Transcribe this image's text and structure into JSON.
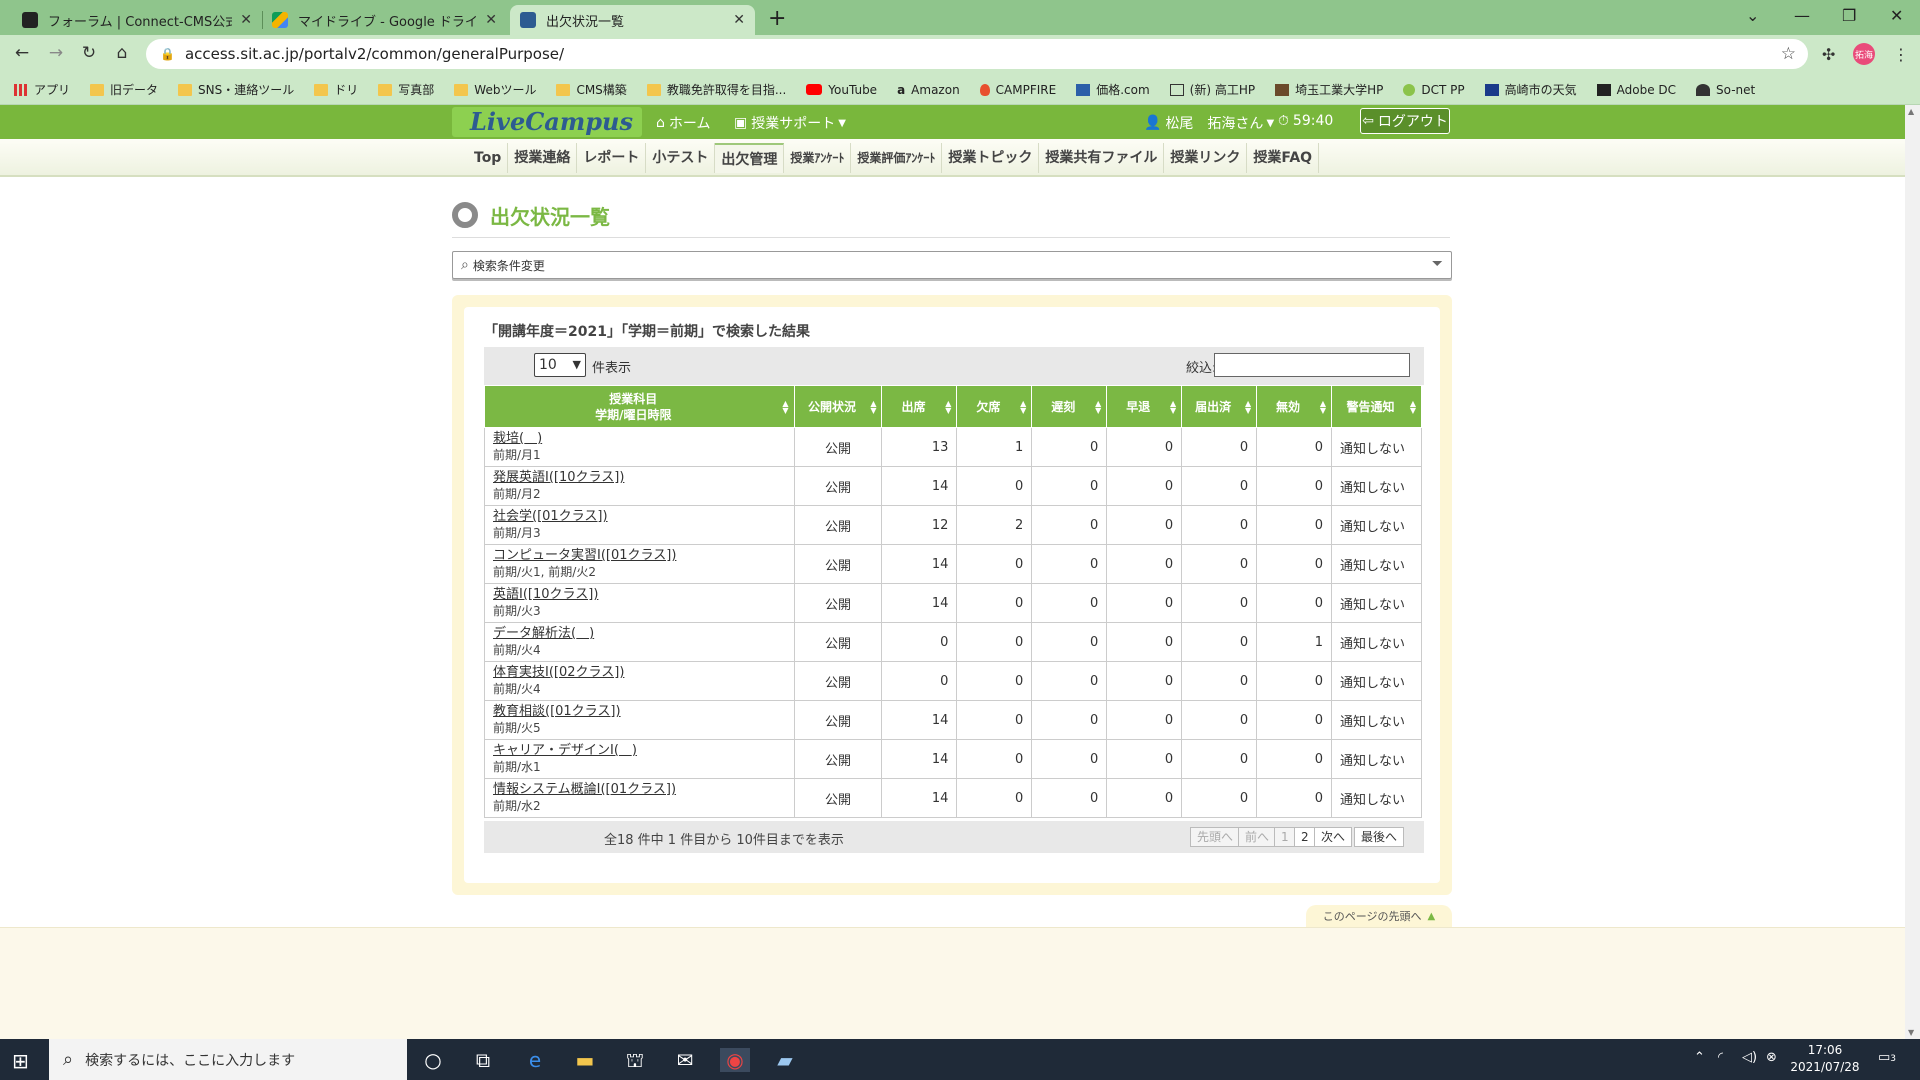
{
  "browser": {
    "tabs": [
      {
        "label": "フォーラム | Connect-CMS公式サイト"
      },
      {
        "label": "マイドライブ - Google ドライブ"
      },
      {
        "label": "出欠状況一覧"
      }
    ],
    "url": "access.sit.ac.jp/portalv2/common/generalPurpose/",
    "profile_initials": "拓海",
    "bookmarks": [
      {
        "label": "アプリ",
        "icon": "apps-icon"
      },
      {
        "label": "旧データ",
        "icon": "folder-icon"
      },
      {
        "label": "SNS・連絡ツール",
        "icon": "folder-icon"
      },
      {
        "label": "ドリ",
        "icon": "folder-icon"
      },
      {
        "label": "写真部",
        "icon": "folder-icon"
      },
      {
        "label": "Webツール",
        "icon": "folder-icon"
      },
      {
        "label": "CMS構築",
        "icon": "folder-icon"
      },
      {
        "label": "教職免許取得を目指...",
        "icon": "folder-icon"
      },
      {
        "label": "YouTube",
        "icon": "youtube-icon"
      },
      {
        "label": "Amazon",
        "icon": "amazon-icon"
      },
      {
        "label": "CAMPFIRE",
        "icon": "campfire-icon"
      },
      {
        "label": "価格.com",
        "icon": "kakaku-icon"
      },
      {
        "label": "(新) 高工HP",
        "icon": "school-icon"
      },
      {
        "label": "埼玉工業大学HP",
        "icon": "university-icon"
      },
      {
        "label": "DCT PP",
        "icon": "dct-icon"
      },
      {
        "label": "高崎市の天気",
        "icon": "weather-icon"
      },
      {
        "label": "Adobe DC",
        "icon": "adobe-icon"
      },
      {
        "label": "So-net",
        "icon": "sonet-icon"
      }
    ]
  },
  "site": {
    "logo": "LiveCampus",
    "nav": {
      "home": "ホーム",
      "support": "授業サポート",
      "user": "松尾　拓海さん",
      "timer": "59:40",
      "logout": "ログアウト"
    },
    "subnav": [
      "Top",
      "授業連絡",
      "レポート",
      "小テスト",
      "出欠管理",
      "授業ｱﾝｹｰﾄ",
      "授業評価ｱﾝｹｰﾄ",
      "授業トピック",
      "授業共有ファイル",
      "授業リンク",
      "授業FAQ"
    ],
    "subnav_active": "出欠管理"
  },
  "page": {
    "title": "出欠状況一覧",
    "search_toggle": "検索条件変更",
    "result_summary": "「開講年度＝2021」「学期＝前期」で検索した結果",
    "page_size": "10",
    "page_size_label": "件表示",
    "filter_label": "絞込:",
    "columns": [
      "授業科目",
      "学期/曜日時限",
      "公開状況",
      "出席",
      "欠席",
      "遅刻",
      "早退",
      "届出済",
      "無効",
      "警告通知"
    ],
    "rows": [
      {
        "course": "栽培(＿)",
        "term": "前期/月1",
        "status": "公開",
        "present": "13",
        "absent": "1",
        "late": "0",
        "early": "0",
        "excused": "0",
        "invalid": "0",
        "warning": "通知しない"
      },
      {
        "course": "発展英語I([10クラス])",
        "term": "前期/月2",
        "status": "公開",
        "present": "14",
        "absent": "0",
        "late": "0",
        "early": "0",
        "excused": "0",
        "invalid": "0",
        "warning": "通知しない"
      },
      {
        "course": "社会学([01クラス])",
        "term": "前期/月3",
        "status": "公開",
        "present": "12",
        "absent": "2",
        "late": "0",
        "early": "0",
        "excused": "0",
        "invalid": "0",
        "warning": "通知しない"
      },
      {
        "course": "コンピュータ実習I([01クラス])",
        "term": "前期/火1, 前期/火2",
        "status": "公開",
        "present": "14",
        "absent": "0",
        "late": "0",
        "early": "0",
        "excused": "0",
        "invalid": "0",
        "warning": "通知しない"
      },
      {
        "course": "英語I([10クラス])",
        "term": "前期/火3",
        "status": "公開",
        "present": "14",
        "absent": "0",
        "late": "0",
        "early": "0",
        "excused": "0",
        "invalid": "0",
        "warning": "通知しない"
      },
      {
        "course": "データ解析法(＿)",
        "term": "前期/火4",
        "status": "公開",
        "present": "0",
        "absent": "0",
        "late": "0",
        "early": "0",
        "excused": "0",
        "invalid": "1",
        "warning": "通知しない"
      },
      {
        "course": "体育実技I([02クラス])",
        "term": "前期/火4",
        "status": "公開",
        "present": "0",
        "absent": "0",
        "late": "0",
        "early": "0",
        "excused": "0",
        "invalid": "0",
        "warning": "通知しない"
      },
      {
        "course": "教育相談([01クラス])",
        "term": "前期/火5",
        "status": "公開",
        "present": "14",
        "absent": "0",
        "late": "0",
        "early": "0",
        "excused": "0",
        "invalid": "0",
        "warning": "通知しない"
      },
      {
        "course": "キャリア・デザインI(＿)",
        "term": "前期/水1",
        "status": "公開",
        "present": "14",
        "absent": "0",
        "late": "0",
        "early": "0",
        "excused": "0",
        "invalid": "0",
        "warning": "通知しない"
      },
      {
        "course": "情報システム概論I([01クラス])",
        "term": "前期/水2",
        "status": "公開",
        "present": "14",
        "absent": "0",
        "late": "0",
        "early": "0",
        "excused": "0",
        "invalid": "0",
        "warning": "通知しない"
      }
    ],
    "pager": {
      "info": "全18 件中 1 件目から 10件目までを表示",
      "first": "先頭へ",
      "prev": "前へ",
      "page1": "1",
      "page2": "2",
      "next": "次へ",
      "last": "最後へ"
    },
    "back_to_top": "このページの先頭へ"
  },
  "taskbar": {
    "search_placeholder": "検索するには、ここに入力します",
    "time": "17:06",
    "date": "2021/07/28",
    "notifications": "3"
  },
  "colors": {
    "brand_green": "#7bb844",
    "tab_bar": "#8fc58c",
    "panel_bg": "#fdf6d6"
  }
}
